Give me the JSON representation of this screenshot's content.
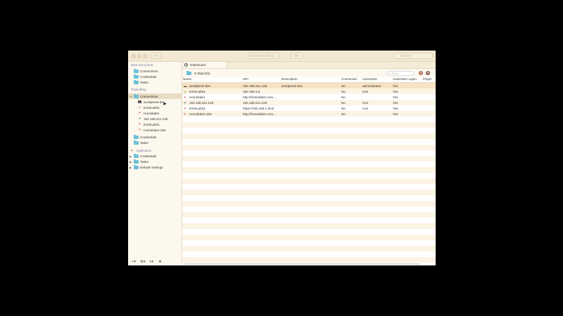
{
  "toolbar": {
    "connect_label": "Connect to Host...",
    "search_placeholder": "Search"
  },
  "sidebar": {
    "new_document": {
      "header": "New Document",
      "items": [
        {
          "label": "Connections",
          "icon": "folder-icon"
        },
        {
          "label": "Credentials",
          "icon": "folder-icon"
        },
        {
          "label": "Tasks",
          "icon": "folder-icon"
        }
      ]
    },
    "teste_blog": {
      "header": "Teste-Blog",
      "connections": {
        "label": "Connections",
        "icon": "folder-icon"
      },
      "hosts": [
        {
          "label": "wordpress-dev",
          "icon": "monitor-icon"
        },
        {
          "label": "ESXiLab01",
          "icon": "globe-icon"
        },
        {
          "label": "Homelaber",
          "icon": "star-icon"
        },
        {
          "label": "192.168.211.128",
          "icon": "tools-icon"
        },
        {
          "label": "ESXiLab01",
          "icon": "star-icon"
        },
        {
          "label": "Homelaber-Site",
          "icon": "star-icon"
        }
      ],
      "items": [
        {
          "label": "Credentials",
          "icon": "folder-icon"
        },
        {
          "label": "Tasks",
          "icon": "folder-icon"
        }
      ]
    },
    "application": {
      "header": "Application",
      "items": [
        {
          "label": "Credentials",
          "icon": "folder-icon"
        },
        {
          "label": "Tasks",
          "icon": "folder-icon"
        },
        {
          "label": "Default Settings",
          "icon": "folder-icon"
        }
      ]
    }
  },
  "main": {
    "tab_label": "Dashboard",
    "object_count": "6 Object(s)",
    "filter_placeholder": "Filter",
    "columns": [
      "Name",
      "URI",
      "Description",
      "Connected",
      "Username",
      "Automatic Logon",
      "Plugin"
    ],
    "rows": [
      {
        "name": "wordpress-dev",
        "icon": "monitor-icon",
        "uri": "192.168.211.128",
        "description": "wordpress-dev",
        "connected": "No",
        "username": "administrator",
        "auto_logon": "Yes"
      },
      {
        "name": "ESXiLab01",
        "icon": "globe-icon",
        "uri": "192.168.1.5",
        "description": "",
        "connected": "No",
        "username": "root",
        "auto_logon": "Yes"
      },
      {
        "name": "Homelaber",
        "icon": "star-icon",
        "uri": "http://homelaber.com....",
        "description": "",
        "connected": "No",
        "username": "",
        "auto_logon": "Yes"
      },
      {
        "name": "192.168.211.128",
        "icon": "tools-icon",
        "uri": "192.168.211.128",
        "description": "",
        "connected": "No",
        "username": "root",
        "auto_logon": "Yes"
      },
      {
        "name": "ESXiLab01",
        "icon": "star-icon",
        "uri": "https://192.168.1.5/ui/",
        "description": "",
        "connected": "No",
        "username": "root",
        "auto_logon": "Yes"
      },
      {
        "name": "Homelaber-Site",
        "icon": "star-icon",
        "uri": "http://homelaber.com....",
        "description": "",
        "connected": "No",
        "username": "",
        "auto_logon": "Yes"
      }
    ]
  },
  "colors": {
    "selected_row": "#f6e3c4",
    "stripe": "#fbf3e3",
    "folder": "#6ec1d8",
    "header_text": "#7a7a9a"
  }
}
